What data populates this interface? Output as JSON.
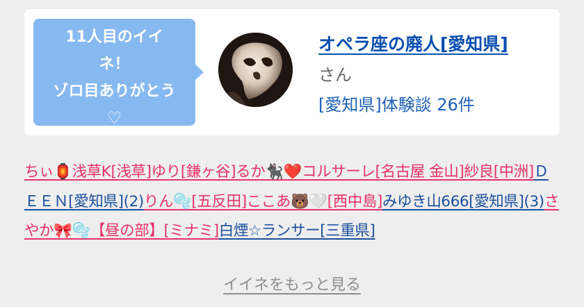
{
  "like_bubble": {
    "lines": [
      "11人目のイイ",
      "ネ！",
      "ゾロ目ありがとう"
    ],
    "heart": "♡"
  },
  "profile": {
    "name": "オペラ座の廃人[愛知県]",
    "suffix": "さん",
    "reviews": "[愛知県]体験談 26件",
    "avatar_icon": "phantom-mask-icon"
  },
  "liked_by": [
    {
      "text": "ちぃ🏮浅草K[浅草]",
      "color": "pink"
    },
    {
      "text": "ゆり[鎌ヶ谷]",
      "color": "pink"
    },
    {
      "text": "るか🐈‍⬛❤️コルサーレ[名古屋 金山]",
      "color": "pink"
    },
    {
      "text": "紗良[中洲]",
      "color": "pink"
    },
    {
      "text": "ＤＥＥＮ[愛知県](2)",
      "color": "blue"
    },
    {
      "text": "りん🫧[五反田]",
      "color": "pink"
    },
    {
      "text": "ここあ🐻🤍[西中島]",
      "color": "pink"
    },
    {
      "text": "みゆき山666[愛知県](3)",
      "color": "blue"
    },
    {
      "text": "さやか🎀🫧【昼の部】[ミナミ]",
      "color": "pink"
    },
    {
      "text": "白煙☆ランサー[三重県]",
      "color": "blue"
    }
  ],
  "more_link": "イイネをもっと見る",
  "colors": {
    "bubble": "#87b9f1",
    "link_blue": "#0c4fb0",
    "pink": "#e8316a",
    "background": "#eeeeee"
  }
}
